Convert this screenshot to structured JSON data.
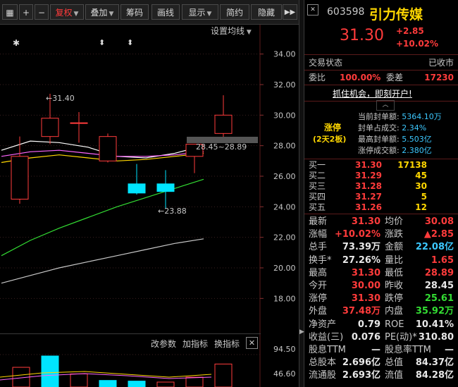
{
  "toolbar": {
    "buttons": [
      "复权",
      "叠加",
      "筹码",
      "画线",
      "显示",
      "简约",
      "隐藏"
    ],
    "more": "▶▶"
  },
  "chart": {
    "indicator_label": "设置均线",
    "right_axis_ticks": [
      "34.00",
      "32.00",
      "30.00",
      "28.00",
      "26.00",
      "24.00",
      "22.00",
      "20.00",
      "18.00"
    ],
    "high_annotation": "31.40",
    "low_annotation": "23.88",
    "range_label": "28.45~28.89",
    "bottom_menu": [
      "改参数",
      "加指标",
      "换指标"
    ],
    "close_x": "✕",
    "volume_ticks": [
      "94.50",
      "46.60"
    ]
  },
  "chart_data": {
    "type": "candlestick",
    "ylim": [
      17,
      35
    ],
    "candles": [
      {
        "open": 24.5,
        "close": 27.3,
        "high": 28.6,
        "low": 24.2
      },
      {
        "open": 28.6,
        "close": 29.8,
        "high": 31.4,
        "low": 28.1
      },
      {
        "open": 29.5,
        "close": 29.5,
        "high": 30.2,
        "low": 28.2
      },
      {
        "open": 27.0,
        "close": 28.6,
        "high": 28.8,
        "low": 26.9
      },
      {
        "open": 25.5,
        "close": 24.9,
        "high": 26.8,
        "low": 24.8
      },
      {
        "open": 25.5,
        "close": 25.0,
        "high": 26.4,
        "low": 23.88
      },
      {
        "open": 27.3,
        "close": 28.1,
        "high": 28.1,
        "low": 26.2
      },
      {
        "open": 28.8,
        "close": 30.0,
        "high": 31.3,
        "low": 28.2
      }
    ],
    "ma_lines": [
      {
        "color": "#ffffff",
        "values": [
          27.7,
          28.3,
          28.2,
          27.9,
          27.3,
          27.2,
          27.5,
          28.0
        ]
      },
      {
        "color": "#ffd700",
        "values": [
          26.9,
          27.2,
          27.4,
          27.2,
          27.0,
          27.1,
          27.3,
          27.5
        ]
      },
      {
        "color": "#ff66ff",
        "values": [
          27.3,
          27.6,
          27.7,
          27.5,
          27.3,
          27.3,
          27.4,
          27.6
        ]
      },
      {
        "color": "#33dd33",
        "values": [
          20.8,
          21.8,
          22.6,
          23.3,
          24.0,
          24.6,
          25.2,
          25.8
        ]
      },
      {
        "color": "#c8c8c8",
        "values": [
          19.0,
          19.5,
          20.0,
          20.4,
          20.8,
          21.2,
          21.6,
          21.9
        ]
      }
    ],
    "volume": [
      {
        "v": 60,
        "up": true
      },
      {
        "v": 94.5,
        "up": false
      },
      {
        "v": 40,
        "up": true
      },
      {
        "v": 20,
        "up": false
      },
      {
        "v": 18,
        "up": false
      },
      {
        "v": 15,
        "up": true
      },
      {
        "v": 30,
        "up": true
      },
      {
        "v": 70,
        "up": true
      }
    ]
  },
  "quote": {
    "code": "603598",
    "name": "引力传媒",
    "price": "31.30",
    "change": "+2.85",
    "change_pct": "+10.02%",
    "trade_status_label": "交易状态",
    "trade_status_value": "已收市",
    "weibi_label": "委比",
    "weibi_value": "100.00%",
    "weicha_label": "委差",
    "weicha_value": "17230",
    "promo": "抓住机会，即刻开户!",
    "limit": {
      "title": "涨停",
      "subtitle": "(2天2板)",
      "rows": [
        {
          "label": "当前封单额:",
          "value": "5364.10万"
        },
        {
          "label": "封单占成交:",
          "value": "2.34%"
        },
        {
          "label": "最高封单额:",
          "value": "5.503亿"
        },
        {
          "label": "涨停成交额:",
          "value": "2.380亿"
        }
      ]
    },
    "bids": [
      {
        "label": "买一",
        "price": "31.30",
        "vol": "17138"
      },
      {
        "label": "买二",
        "price": "31.29",
        "vol": "45"
      },
      {
        "label": "买三",
        "price": "31.28",
        "vol": "30"
      },
      {
        "label": "买四",
        "price": "31.27",
        "vol": "5"
      },
      {
        "label": "买五",
        "price": "31.26",
        "vol": "12"
      }
    ],
    "stats": [
      {
        "l1": "最新",
        "v1": "31.30",
        "c1": "red",
        "l2": "均价",
        "v2": "30.08",
        "c2": "red"
      },
      {
        "l1": "涨幅",
        "v1": "+10.02%",
        "c1": "red",
        "l2": "涨跌",
        "v2": "▲2.85",
        "c2": "red"
      },
      {
        "l1": "总手",
        "v1": "73.39万",
        "c1": "wht",
        "l2": "金额",
        "v2": "22.08亿",
        "c2": "cy"
      },
      {
        "l1": "换手*",
        "v1": "27.26%",
        "c1": "wht",
        "l2": "量比",
        "v2": "1.65",
        "c2": "red"
      },
      {
        "l1": "最高",
        "v1": "31.30",
        "c1": "red",
        "l2": "最低",
        "v2": "28.89",
        "c2": "red"
      },
      {
        "l1": "今开",
        "v1": "30.00",
        "c1": "red",
        "l2": "昨收",
        "v2": "28.45",
        "c2": "wht"
      },
      {
        "l1": "涨停",
        "v1": "31.30",
        "c1": "red",
        "l2": "跌停",
        "v2": "25.61",
        "c2": "grn"
      },
      {
        "l1": "外盘",
        "v1": "37.48万",
        "c1": "red",
        "l2": "内盘",
        "v2": "35.92万",
        "c2": "grn"
      },
      {
        "l1": "净资产",
        "v1": "0.79",
        "c1": "wht",
        "l2": "ROE",
        "v2": "10.41%",
        "c2": "wht"
      },
      {
        "l1": "收益(三)",
        "v1": "0.076",
        "c1": "wht",
        "l2": "PE(动)*",
        "v2": "310.80",
        "c2": "wht"
      },
      {
        "l1": "股息TTM",
        "v1": "—",
        "c1": "wht",
        "l2": "股息率TTM",
        "v2": "—",
        "c2": "wht"
      },
      {
        "l1": "总股本",
        "v1": "2.696亿",
        "c1": "wht",
        "l2": "总值",
        "v2": "84.37亿",
        "c2": "wht"
      },
      {
        "l1": "流通股",
        "v1": "2.693亿",
        "c1": "wht",
        "l2": "流值",
        "v2": "84.28亿",
        "c2": "wht"
      }
    ]
  }
}
